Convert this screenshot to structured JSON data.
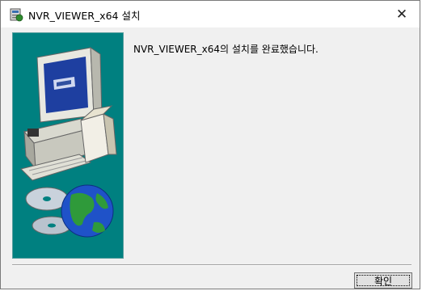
{
  "window": {
    "title": "NVR_VIEWER_x64 설치",
    "close_glyph": "✕"
  },
  "main": {
    "message": "NVR_VIEWER_x64의 설치를 완료했습니다."
  },
  "footer": {
    "ok_label": "확인"
  },
  "colors": {
    "panel_bg": "#008080",
    "dialog_bg": "#f0f0f0"
  }
}
